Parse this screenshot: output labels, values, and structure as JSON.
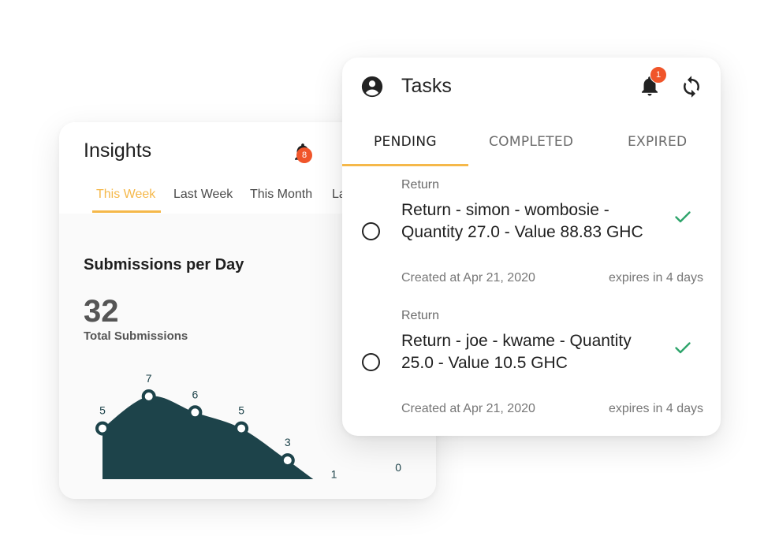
{
  "insights": {
    "title": "Insights",
    "notification_count": "8",
    "tabs": [
      {
        "label": "This Week",
        "active": true
      },
      {
        "label": "Last Week",
        "active": false
      },
      {
        "label": "This Month",
        "active": false
      },
      {
        "label": "La",
        "active": false
      }
    ],
    "section_title": "Submissions per Day",
    "total_value": "32",
    "total_label": "Total Submissions",
    "chart_data": {
      "type": "area",
      "title": "Submissions per Day",
      "xlabel": "",
      "ylabel": "",
      "values": [
        5,
        7,
        6,
        5,
        3,
        1,
        0
      ],
      "data_labels": [
        "5",
        "7",
        "6",
        "5",
        "3",
        "1",
        "0"
      ],
      "fill_color": "#1d434a",
      "grid": false
    }
  },
  "tasks": {
    "title": "Tasks",
    "notification_count": "1",
    "tabs": [
      {
        "label": "PENDING",
        "active": true
      },
      {
        "label": "COMPLETED",
        "active": false
      },
      {
        "label": "EXPIRED",
        "active": false
      }
    ],
    "items": [
      {
        "category": "Return",
        "description": "Return - simon - wombosie - Quantity 27.0 - Value 88.83 GHC",
        "created": "Created at Apr 21, 2020",
        "expires": "expires in 4 days"
      },
      {
        "category": "Return",
        "description": "Return - joe - kwame - Quantity 25.0 - Value 10.5 GHC",
        "created": "Created at Apr 21, 2020",
        "expires": "expires in 4 days"
      }
    ]
  },
  "colors": {
    "accent": "#f5b84a",
    "badge": "#f0552a",
    "chart_fill": "#1d434a",
    "check": "#2ea46b"
  },
  "icons": {
    "insights_bell": "bell-icon",
    "tasks_bell": "bell-icon",
    "account": "account-circle-icon",
    "sync": "sync-icon",
    "check": "check-icon"
  }
}
